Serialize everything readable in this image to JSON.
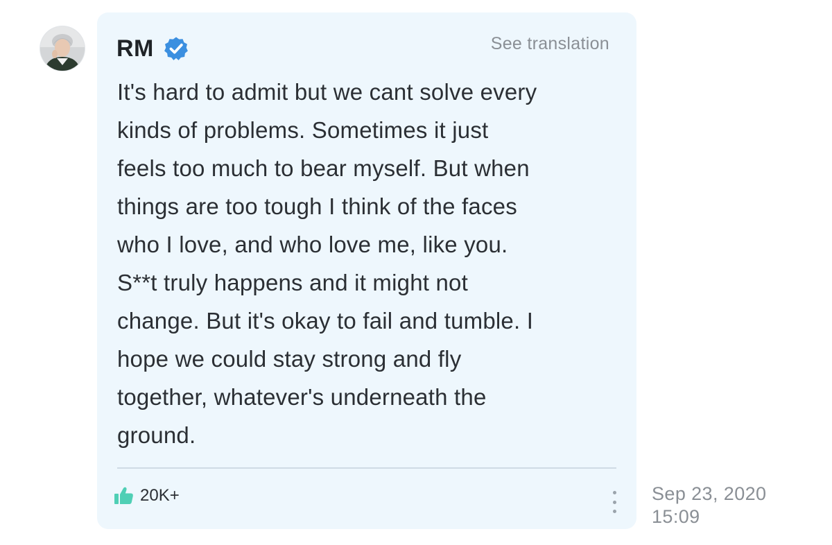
{
  "post": {
    "author": {
      "name": "RM",
      "verified": true,
      "avatar_icon": "profile-photo-avatar"
    },
    "see_translation_label": "See translation",
    "message": "It's hard to admit but we cant solve every\nkinds of problems. Sometimes it just\nfeels too much to bear myself. But when\nthings are too tough I think of the faces\nwho I love, and who love me, like you.\nS**t truly happens and it might not\nchange. But it's okay to fail and tumble. I\nhope we could stay strong and fly\ntogether, whatever's underneath the\nground.",
    "likes": {
      "count": "20K+",
      "icon": "thumbs-up-icon"
    },
    "more_icon": "more-vertical-icon",
    "timestamp": {
      "date": "Sep 23, 2020",
      "time": "15:09"
    }
  },
  "colors": {
    "bubble_background": "#eef7fd",
    "verified_badge": "#3b8fe0",
    "like_icon": "#4fcfb5",
    "muted_text": "#8a8f95",
    "body_text": "#2b2f34"
  }
}
